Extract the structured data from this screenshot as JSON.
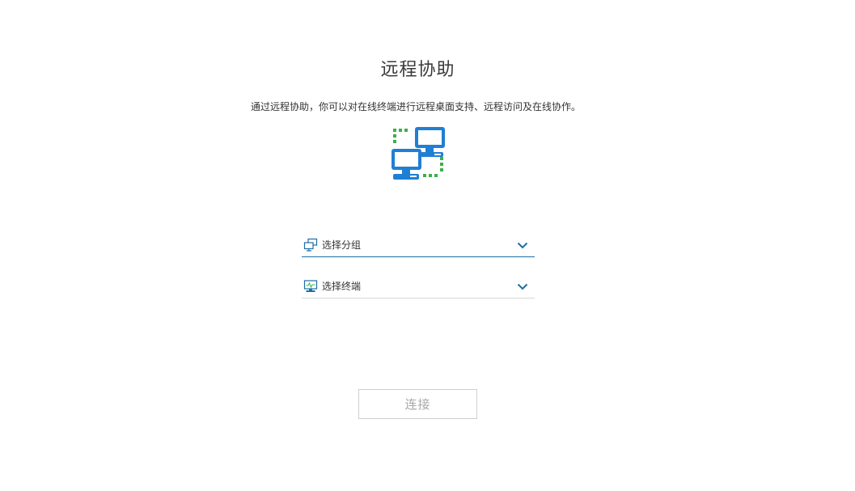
{
  "header": {
    "title": "远程协助",
    "description": "通过远程协助，你可以对在线终端进行远程桌面支持、远程访问及在线协作。"
  },
  "hero": {
    "icon": "remote-computers-icon",
    "primary_color": "#1f7fd4",
    "accent_color": "#3cb04a"
  },
  "form": {
    "group_select": {
      "label": "选择分组",
      "icon": "group-icon",
      "active": true
    },
    "terminal_select": {
      "label": "选择终端",
      "icon": "monitor-icon",
      "active": false
    }
  },
  "actions": {
    "connect_label": "连接",
    "connect_disabled": true
  },
  "colors": {
    "accent": "#1d6fa5",
    "disabled_text": "#a8a8a8"
  }
}
